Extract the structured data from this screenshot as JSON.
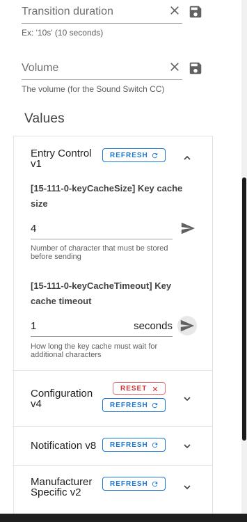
{
  "fields": {
    "transition": {
      "placeholder": "Transition duration",
      "hint": "Ex: '10s' (10 seconds)"
    },
    "volume": {
      "placeholder": "Volume",
      "hint": "The volume (for the Sound Switch CC)"
    }
  },
  "values_title": "Values",
  "sections": {
    "entry_control": {
      "title_line1": "Entry Control",
      "title_line2": "v1",
      "refresh_label": "REFRESH",
      "params": {
        "key_cache_size": {
          "title": "[15-111-0-keyCacheSize] Key cache size",
          "value": "4",
          "hint": "Number of character that must be stored before sending"
        },
        "key_cache_timeout": {
          "title": "[15-111-0-keyCacheTimeout] Key cache timeout",
          "value": "1",
          "suffix": "seconds",
          "hint": "How long the key cache must wait for additional characters"
        }
      }
    },
    "configuration": {
      "title_line1": "Configuration",
      "title_line2": "v4",
      "reset_label": "RESET",
      "refresh_label": "REFRESH"
    },
    "notification": {
      "title": "Notification v8",
      "refresh_label": "REFRESH"
    },
    "manufacturer": {
      "title_line1": "Manufacturer",
      "title_line2": "Specific v2",
      "refresh_label": "REFRESH"
    }
  },
  "colors": {
    "accent": "#1976d2",
    "danger": "#d32f2f"
  }
}
